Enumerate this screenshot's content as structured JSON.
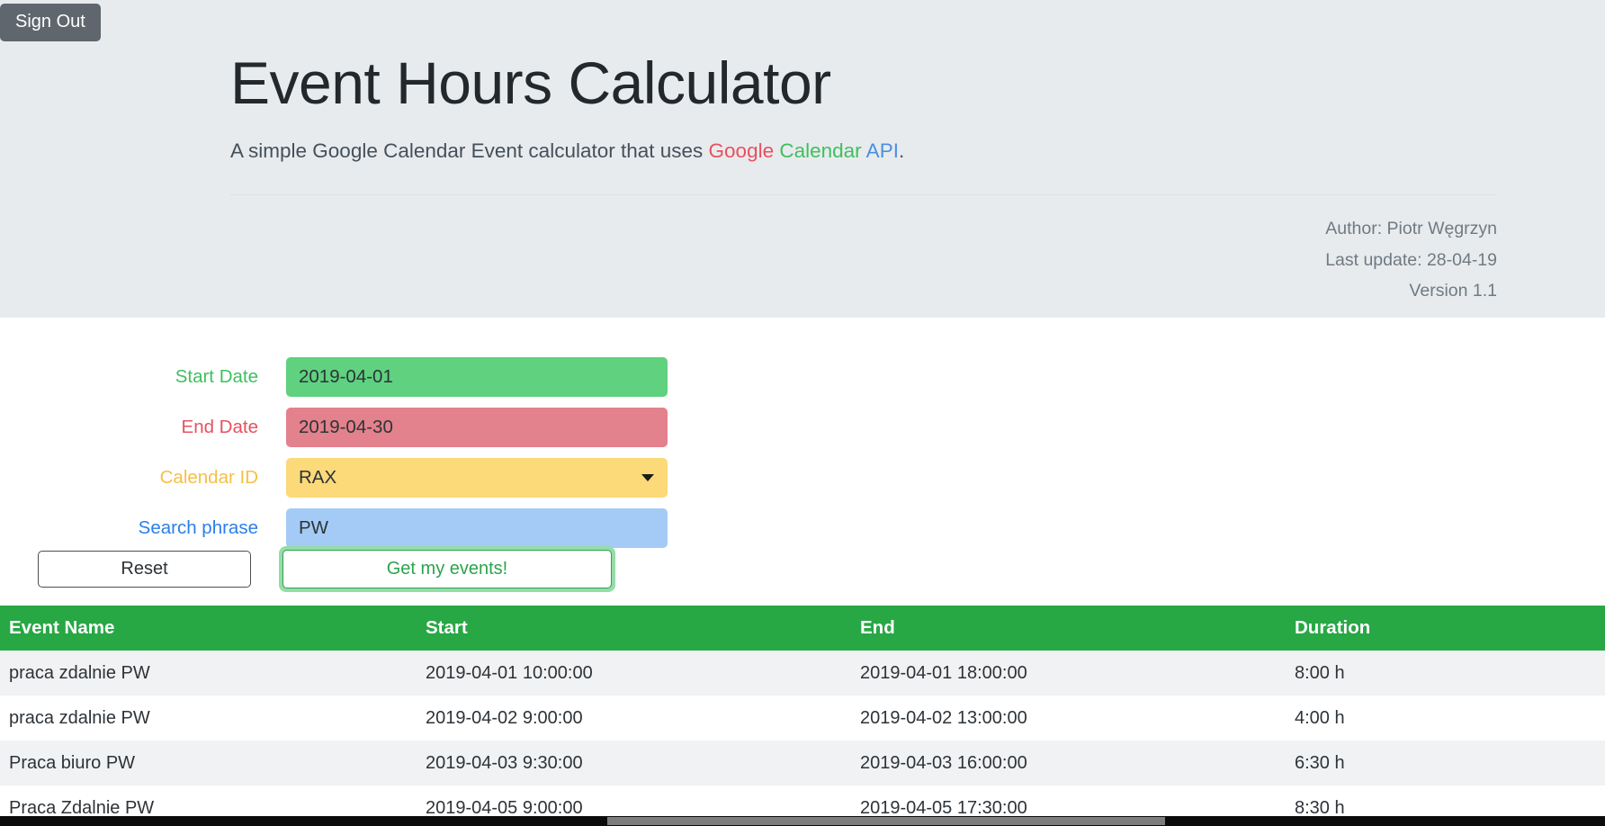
{
  "header": {
    "signout_label": "Sign Out",
    "title": "Event Hours Calculator",
    "subtitle_prefix": "A simple Google Calendar Event calculator that uses ",
    "subtitle_api_google": "Google",
    "subtitle_api_calendar": " Calendar",
    "subtitle_api_api": " API",
    "subtitle_suffix": ".",
    "author": "Author: Piotr Węgrzyn",
    "last_update": "Last update: 28-04-19",
    "version": "Version 1.1",
    "colors": {
      "background": "#e8ebed",
      "signout_bg": "#5f666d",
      "google_red": "#e8505f",
      "google_green": "#3fbf5f",
      "google_blue": "#4a90e2"
    }
  },
  "form": {
    "fields": [
      {
        "label": "Start Date",
        "value": "2019-04-01",
        "placeholder": "YYYY-MM-DD",
        "color": "#5fd17f",
        "label_color": "#3fbf5f"
      },
      {
        "label": "End Date",
        "value": "2019-04-30",
        "placeholder": "YYYY-MM-DD",
        "color": "#e3818c",
        "label_color": "#e8505f"
      },
      {
        "label": "Calendar ID",
        "value": "RAX",
        "placeholder": "Select calendar",
        "color": "#fcd979",
        "label_color": "#f5c046"
      },
      {
        "label": "Search phrase",
        "value": "PW",
        "placeholder": "Search phrase",
        "color": "#a4cbf5",
        "label_color": "#2a7fe8"
      }
    ],
    "calendar_options": [
      "RAX"
    ],
    "reset_label": "Reset",
    "submit_label": "Get my events!"
  },
  "table": {
    "headers": [
      "Event Name",
      "Start",
      "End",
      "Duration"
    ],
    "header_bg": "#28a745",
    "rows": [
      {
        "name": "praca zdalnie PW",
        "start": "2019-04-01 10:00:00",
        "end": "2019-04-01 18:00:00",
        "duration": "8:00 h"
      },
      {
        "name": "praca zdalnie PW",
        "start": "2019-04-02 9:00:00",
        "end": "2019-04-02 13:00:00",
        "duration": "4:00 h"
      },
      {
        "name": "Praca biuro PW",
        "start": "2019-04-03 9:30:00",
        "end": "2019-04-03 16:00:00",
        "duration": "6:30 h"
      },
      {
        "name": "Praca Zdalnie PW",
        "start": "2019-04-05 9:00:00",
        "end": "2019-04-05 17:30:00",
        "duration": "8:30 h"
      }
    ]
  }
}
